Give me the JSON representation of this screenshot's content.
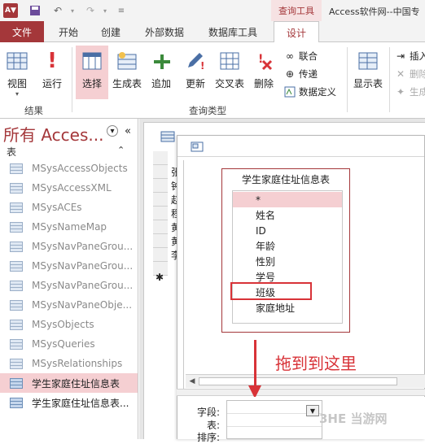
{
  "titlebar": {
    "app_icon": "A▼",
    "window_title": "Access软件网--中国专",
    "context_tab": "查询工具"
  },
  "tabs": [
    "文件",
    "开始",
    "创建",
    "外部数据",
    "数据库工具",
    "设计"
  ],
  "ribbon": {
    "results_group": {
      "label": "结果",
      "buttons": [
        "视图",
        "运行"
      ]
    },
    "query_type_group": {
      "label": "查询类型",
      "buttons": [
        "选择",
        "生成表",
        "追加",
        "更新",
        "交叉表",
        "删除"
      ],
      "small_buttons": [
        "联合",
        "传递",
        "数据定义"
      ]
    },
    "setup_group": {
      "buttons": [
        "显示表"
      ],
      "small_buttons": [
        "插入",
        "删除",
        "生成"
      ]
    }
  },
  "nav": {
    "title": "所有 Acces...",
    "section": "表",
    "items": [
      {
        "label": "MSysAccessObjects"
      },
      {
        "label": "MSysAccessXML"
      },
      {
        "label": "MSysACEs"
      },
      {
        "label": "MSysNameMap"
      },
      {
        "label": "MSysNavPaneGrou..."
      },
      {
        "label": "MSysNavPaneGrou..."
      },
      {
        "label": "MSysNavPaneGrou..."
      },
      {
        "label": "MSysNavPaneObje..."
      },
      {
        "label": "MSysObjects"
      },
      {
        "label": "MSysQueries"
      },
      {
        "label": "MSysRelationships"
      },
      {
        "label": "学生家庭住址信息表"
      },
      {
        "label": "学生家庭住址信息表..."
      }
    ]
  },
  "background_table": {
    "cells": [
      "张",
      "钟",
      "赵",
      "程",
      "黄",
      "黄",
      "李"
    ],
    "new_row": "✱"
  },
  "field_list": {
    "title": "学生家庭住址信息表",
    "fields": [
      "*",
      "姓名",
      "ID",
      "年龄",
      "性别",
      "学号",
      "班级",
      "家庭地址"
    ]
  },
  "annotation": "拖到到这里",
  "design_grid": {
    "row_labels": [
      "字段:",
      "表:",
      "排序:"
    ]
  },
  "watermark": "3HE 当游网",
  "colors": {
    "accent": "#a4373a",
    "selection": "#f5cfd2",
    "annotation": "#d83338"
  }
}
